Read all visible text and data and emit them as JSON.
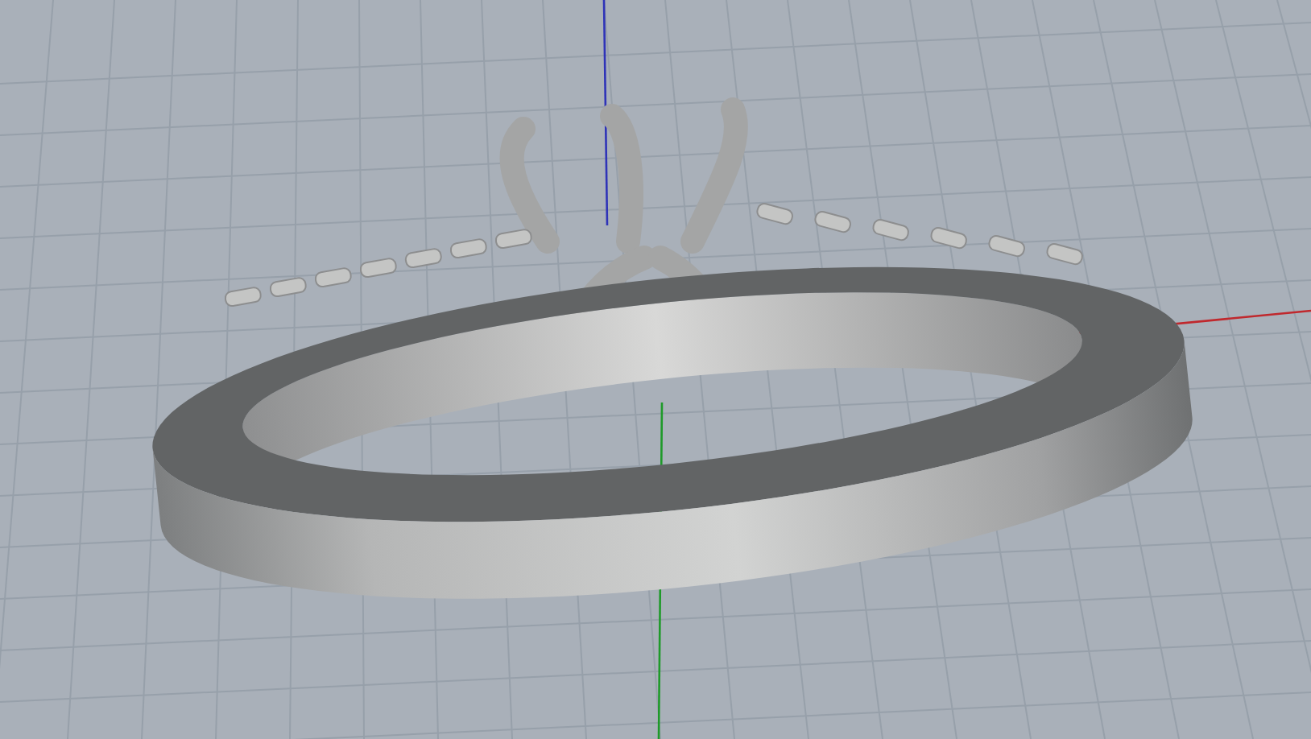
{
  "viewport": {
    "axes": [
      {
        "kind": "x",
        "color": "#c0282d"
      },
      {
        "kind": "y",
        "color": "#1f9a2a"
      },
      {
        "kind": "z",
        "color": "#2f33b8"
      }
    ]
  }
}
